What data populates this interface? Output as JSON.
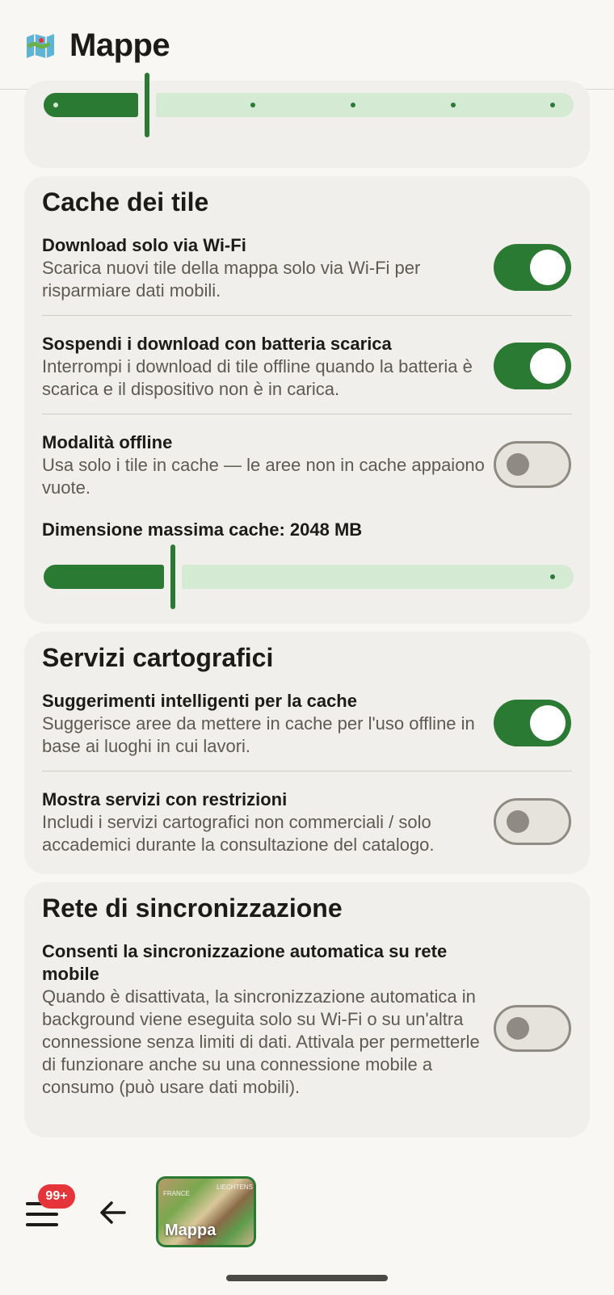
{
  "header": {
    "title": "Mappe",
    "icon": "map-icon"
  },
  "tile_cache": {
    "title": "Cache dei tile",
    "items": [
      {
        "title": "Download solo via Wi-Fi",
        "desc": "Scarica nuovi tile della mappa solo via Wi-Fi per risparmiare dati mobili.",
        "enabled": true
      },
      {
        "title": "Sospendi i download con batteria scarica",
        "desc": "Interrompi i download di tile offline quando la batteria è scarica e il dispositivo non è in carica.",
        "enabled": true
      },
      {
        "title": "Modalità offline",
        "desc": "Usa solo i tile in cache — le aree non in cache appaiono vuote.",
        "enabled": false
      }
    ],
    "cache_size_label": "Dimensione massima cache: 2048 MB",
    "cache_slider_fraction": 0.24
  },
  "top_slider_fraction": 0.19,
  "map_services": {
    "title": "Servizi cartografici",
    "items": [
      {
        "title": "Suggerimenti intelligenti per la cache",
        "desc": "Suggerisce aree da mettere in cache per l'uso offline in base ai luoghi in cui lavori.",
        "enabled": true
      },
      {
        "title": "Mostra servizi con restrizioni",
        "desc": "Includi i servizi cartografici non commerciali / solo accademici durante la consultazione del catalogo.",
        "enabled": false
      }
    ]
  },
  "sync_network": {
    "title": "Rete di sincronizzazione",
    "items": [
      {
        "title": "Consenti la sincronizzazione automatica su rete mobile",
        "desc": "Quando è disattivata, la sincronizzazione automatica in background viene eseguita solo su Wi-Fi o su un'altra connessione senza limiti di dati. Attivala per permetterle di funzionare anche su una connessione mobile a consumo (può usare dati mobili).",
        "enabled": false
      }
    ]
  },
  "bottom_bar": {
    "badge": "99+",
    "map_thumb_label": "Mappa",
    "map_thumb_tiny_left": "FRANCE",
    "map_thumb_tiny_right": "LIECHTENS"
  },
  "colors": {
    "accent": "#2b7a34",
    "track_light": "#d5ead3",
    "badge": "#e5353a"
  }
}
